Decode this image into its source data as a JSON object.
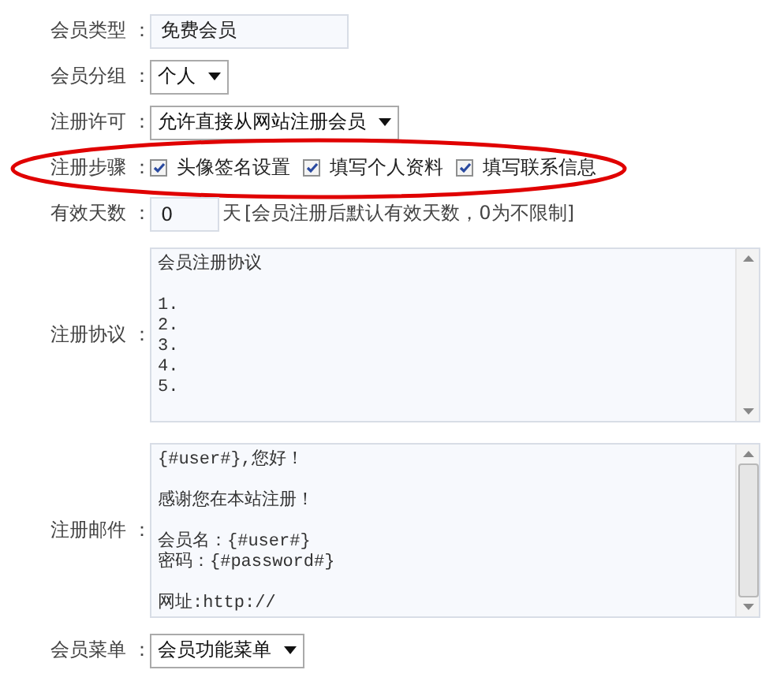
{
  "rows": [
    {
      "kind": "text",
      "label": "会员类型 ：",
      "value": "免费会员"
    },
    {
      "kind": "select",
      "label": "会员分组 ：",
      "value": "个人"
    },
    {
      "kind": "select",
      "label": "注册许可 ：",
      "value": "允许直接从网站注册会员"
    },
    {
      "kind": "checkboxes",
      "label": "注册步骤 ：",
      "circled": true,
      "options": [
        {
          "label": "头像签名设置",
          "checked": true
        },
        {
          "label": "填写个人资料",
          "checked": true
        },
        {
          "label": "填写联系信息",
          "checked": true
        }
      ]
    },
    {
      "kind": "days",
      "label": "有效天数 ：",
      "value": "0",
      "unit": "天",
      "hint": "[会员注册后默认有效天数，0为不限制]"
    },
    {
      "kind": "textarea",
      "label": "注册协议 ：",
      "paragraphs": [
        [
          "会员注册协议"
        ],
        [
          "1.",
          "2.",
          "3.",
          "4.",
          "5."
        ]
      ]
    },
    {
      "kind": "textarea",
      "label": "注册邮件 ：",
      "thumb": true,
      "paragraphs": [
        [
          "{#user#},您好！"
        ],
        [
          "感谢您在本站注册！"
        ],
        [
          "会员名：{#user#}",
          "密码：{#password#}"
        ],
        [
          "网址:http://"
        ]
      ]
    },
    {
      "kind": "select",
      "label": "会员菜单 ：",
      "value": "会员功能菜单"
    }
  ]
}
